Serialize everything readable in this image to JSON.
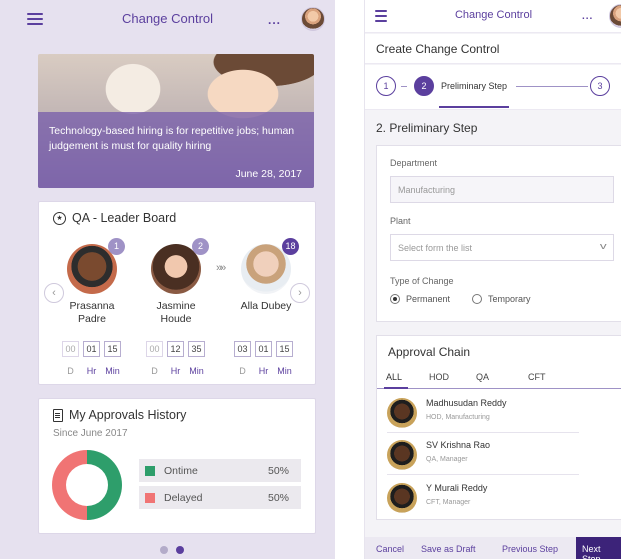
{
  "left": {
    "header": {
      "title": "Change Control",
      "more": "..."
    },
    "hero": {
      "caption": "Technology-based hiring is for repetitive jobs; human judgement is must for quality hiring",
      "date": "June 28, 2017"
    },
    "leaderboard": {
      "title": "QA - Leader Board",
      "between_arrows": "»»",
      "prev": "‹",
      "next": "›",
      "people": [
        {
          "name_line1": "Prasanna",
          "name_line2": "Padre",
          "rank": "1",
          "timer": [
            "00",
            "01",
            "15"
          ],
          "labels": [
            "D",
            "Hr",
            "Min"
          ]
        },
        {
          "name_line1": "Jasmine",
          "name_line2": "Houde",
          "rank": "2",
          "timer": [
            "00",
            "12",
            "35"
          ],
          "labels": [
            "D",
            "Hr",
            "Min"
          ]
        },
        {
          "name_line1": "Alla Dubey",
          "name_line2": "",
          "rank": "18",
          "timer": [
            "03",
            "01",
            "15"
          ],
          "labels": [
            "D",
            "Hr",
            "Min"
          ]
        }
      ]
    },
    "approvals": {
      "title": "My Approvals History",
      "since": "Since June 2017",
      "legend": [
        {
          "label": "Ontime",
          "value": "50%",
          "color": "#2e9e6b"
        },
        {
          "label": "Delayed",
          "value": "50%",
          "color": "#f07474"
        }
      ],
      "ontime_fraction": 0.5
    },
    "pager": {
      "count": 2,
      "active": 1
    }
  },
  "right": {
    "header": {
      "title": "Change Control",
      "more": "..."
    },
    "subheader": "Create Change Control",
    "stepper": {
      "step1": "1",
      "step2": "2",
      "step2_label": "Preliminary Step",
      "step3": "3"
    },
    "section_title": "2. Preliminary Step",
    "form": {
      "department_label": "Department",
      "department_value": "Manufacturing",
      "plant_label": "Plant",
      "plant_placeholder": "Select form the list",
      "type_label": "Type of Change",
      "options": [
        "Permanent",
        "Temporary"
      ],
      "selected": "Permanent"
    },
    "approval_chain": {
      "title": "Approval Chain",
      "tabs": [
        "ALL",
        "HOD",
        "QA",
        "CFT"
      ],
      "active_tab": "ALL",
      "people": [
        {
          "name": "Madhusudan Reddy",
          "role": "HOD, Manufacturing"
        },
        {
          "name": "SV Krishna Rao",
          "role": "QA, Manager"
        },
        {
          "name": "Y Murali Reddy",
          "role": "CFT, Manager"
        }
      ]
    },
    "footer": {
      "cancel": "Cancel",
      "save_draft": "Save as Draft",
      "previous": "Previous Step",
      "next": "Next Step"
    }
  },
  "colors": {
    "brand": "#5b3f9e",
    "brand_dark": "#3c2379",
    "accent_light": "#9f92c6"
  }
}
